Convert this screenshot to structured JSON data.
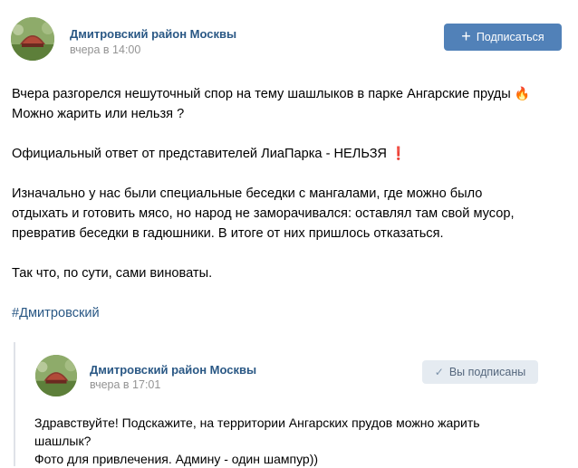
{
  "post": {
    "group_name": "Дмитровский район Москвы",
    "time": "вчера в 14:00",
    "subscribe_label": "Подписаться",
    "subscribe_icon": "plus-icon",
    "text": {
      "line1": "Вчера разгорелся нешуточный спор на тему шашлыков в парке Ангарские пруды",
      "line1_emoji": "🔥",
      "line2": "Можно жарить или нельзя ?",
      "line3": "Официальный ответ от представителей ЛиаПарка - НЕЛЬЗЯ",
      "line3_emoji": "❗",
      "line4": "Изначально у нас были специальные беседки с мангалами, где можно было",
      "line5": "отдыхать и готовить мясо, но народ не заморачивался: оставлял там свой мусор,",
      "line6": "превратив беседки в гадюшники. В итоге от них пришлось отказаться.",
      "line7": "Так что, по сути, сами виноваты.",
      "hashtag": "#Дмитровский"
    }
  },
  "repost": {
    "group_name": "Дмитровский район Москвы",
    "time": "вчера в 17:01",
    "subscribed_label": "Вы подписаны",
    "subscribed_icon": "check-icon",
    "text": {
      "line1": "Здравствуйте! Подскажите, на территории Ангарских прудов можно жарить",
      "line2": "шашлык?",
      "line3": "Фото для привлечения. Админу - один шампур))"
    }
  },
  "colors": {
    "link": "#2a5885",
    "button": "#5181b8",
    "muted": "#939393"
  }
}
